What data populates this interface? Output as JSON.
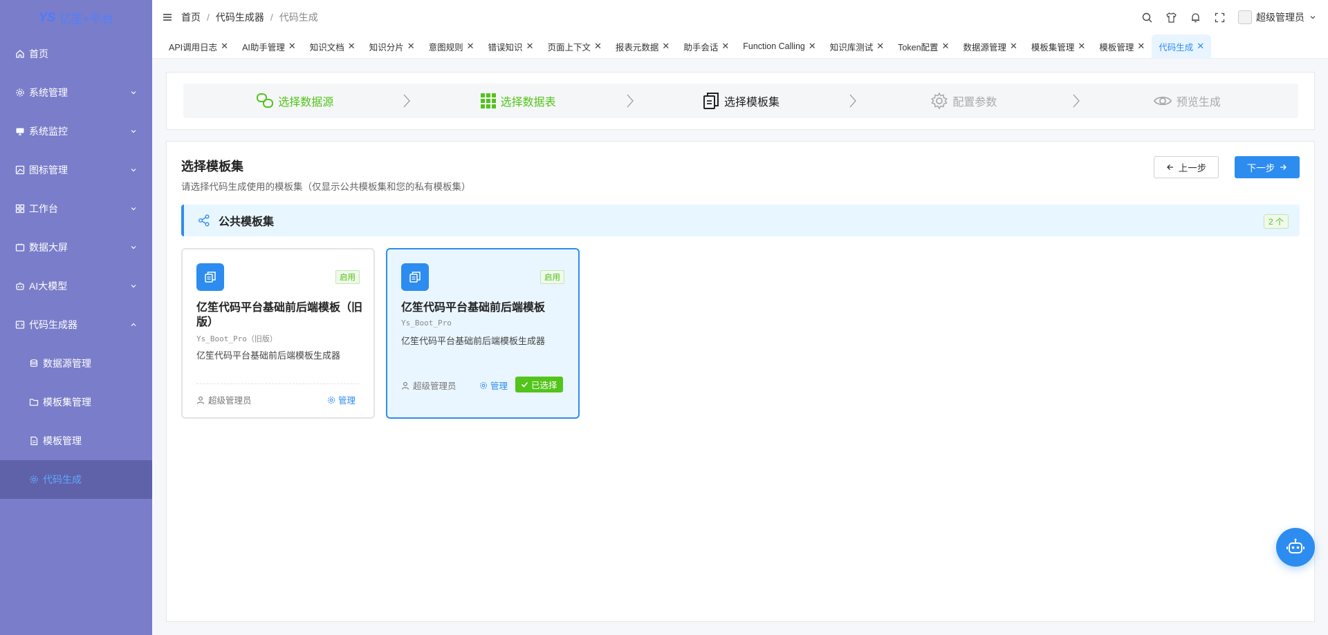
{
  "app": {
    "logo_mark": "YS",
    "logo_text": "亿笙+平台"
  },
  "sidebar": {
    "items": [
      {
        "label": "首页",
        "icon": "home-icon"
      },
      {
        "label": "系统管理",
        "icon": "gear-icon"
      },
      {
        "label": "系统监控",
        "icon": "monitor-icon"
      },
      {
        "label": "图标管理",
        "icon": "image-icon"
      },
      {
        "label": "工作台",
        "icon": "grid-icon"
      },
      {
        "label": "数据大屏",
        "icon": "screen-icon"
      },
      {
        "label": "AI大模型",
        "icon": "robot-icon"
      },
      {
        "label": "代码生成器",
        "icon": "code-icon"
      },
      {
        "label": "数据源管理",
        "icon": "database-icon"
      },
      {
        "label": "模板集管理",
        "icon": "folder-icon"
      },
      {
        "label": "模板管理",
        "icon": "file-icon"
      },
      {
        "label": "代码生成",
        "icon": "gear-icon"
      }
    ]
  },
  "header": {
    "breadcrumb": [
      "首页",
      "代码生成器",
      "代码生成"
    ],
    "user_name": "超级管理员"
  },
  "tabs": [
    {
      "label": "API调用日志"
    },
    {
      "label": "AI助手管理"
    },
    {
      "label": "知识文档"
    },
    {
      "label": "知识分片"
    },
    {
      "label": "意图规则"
    },
    {
      "label": "错误知识"
    },
    {
      "label": "页面上下文"
    },
    {
      "label": "报表元数据"
    },
    {
      "label": "助手会话"
    },
    {
      "label": "Function Calling"
    },
    {
      "label": "知识库测试"
    },
    {
      "label": "Token配置"
    },
    {
      "label": "数据源管理"
    },
    {
      "label": "模板集管理"
    },
    {
      "label": "模板管理"
    },
    {
      "label": "代码生成"
    }
  ],
  "steps": [
    {
      "label": "选择数据源",
      "state": "done"
    },
    {
      "label": "选择数据表",
      "state": "done"
    },
    {
      "label": "选择模板集",
      "state": "current"
    },
    {
      "label": "配置参数",
      "state": "todo"
    },
    {
      "label": "预览生成",
      "state": "todo"
    }
  ],
  "main": {
    "title": "选择模板集",
    "subtitle": "请选择代码生成使用的模板集（仅显示公共模板集和您的私有模板集）",
    "prev_label": "上一步",
    "next_label": "下一步",
    "group": {
      "title": "公共模板集",
      "count": "2 个"
    },
    "cards": [
      {
        "name": "亿笙代码平台基础前后端模板（旧版）",
        "code": "Ys_Boot_Pro（旧版）",
        "desc": "亿笙代码平台基础前后端模板生成器",
        "status": "启用",
        "author": "超级管理员",
        "manage": "管理",
        "selected": false
      },
      {
        "name": "亿笙代码平台基础前后端模板",
        "code": "Ys_Boot_Pro",
        "desc": "亿笙代码平台基础前后端模板生成器",
        "status": "启用",
        "author": "超级管理员",
        "manage": "管理",
        "selected": true,
        "selected_label": "已选择"
      }
    ]
  },
  "colors": {
    "sidebar_bg": "#7a7dc9",
    "sidebar_active_bg": "#5f62a8",
    "primary": "#2d8cf0",
    "success": "#52c41a"
  }
}
